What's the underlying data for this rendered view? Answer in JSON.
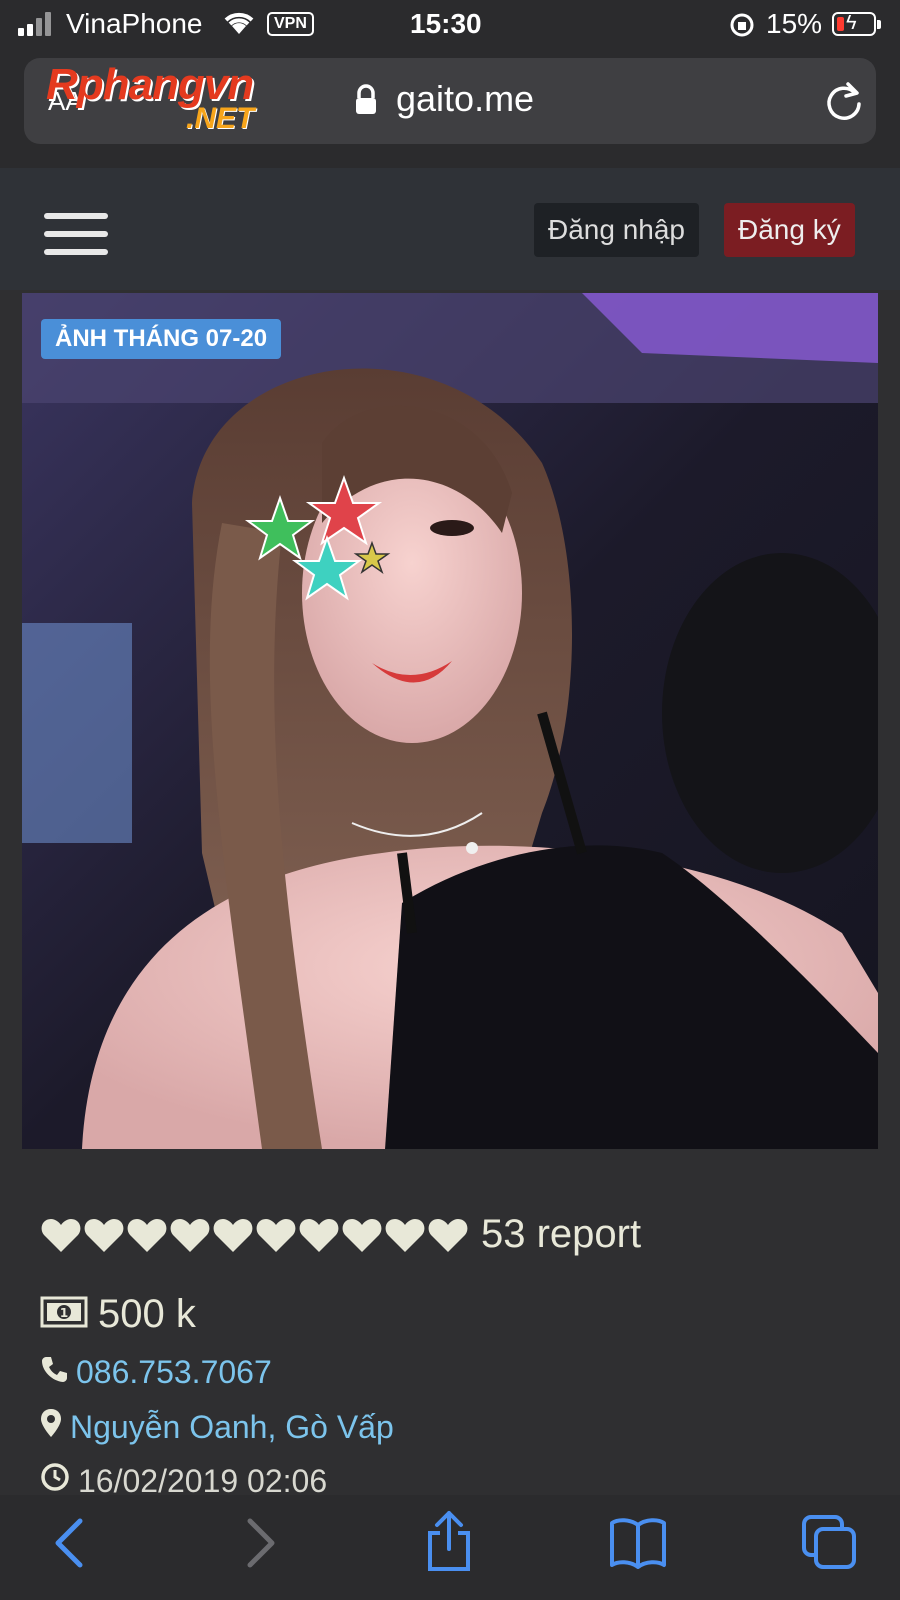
{
  "status_bar": {
    "carrier": "VinaPhone",
    "vpn": "VPN",
    "time": "15:30",
    "battery_percent": "15%"
  },
  "browser": {
    "text_size_label": "AA",
    "domain": "gaito.me"
  },
  "watermark": {
    "main": "Rphangvn",
    "sub": ".NET"
  },
  "header": {
    "login_label": "Đăng nhập",
    "register_label": "Đăng ký"
  },
  "photo": {
    "badge": "ẢNH THÁNG 07-20"
  },
  "listing": {
    "hearts_count": 10,
    "report": "53 report",
    "price": "500 k",
    "phone": "086.753.7067",
    "address": "Nguyễn Oanh, Gò Vấp",
    "date": "16/02/2019 02:06"
  },
  "colors": {
    "link": "#7cc4ec",
    "register_button": "#7b1d22",
    "badge": "#4a8fd8",
    "toolbar_icon": "#4a8ff0"
  }
}
